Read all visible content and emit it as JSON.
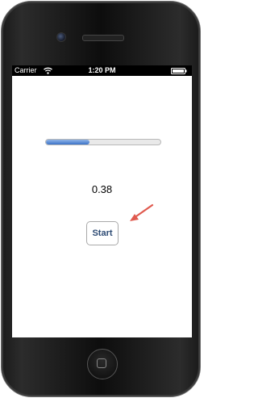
{
  "statusbar": {
    "carrier": "Carrier",
    "time": "1:20 PM"
  },
  "progress": {
    "fraction": 0.38,
    "fill_color": "#3b72c8"
  },
  "main": {
    "value_text": "0.38",
    "start_label": "Start"
  },
  "annotation": {
    "arrow_color": "#e05a4f"
  }
}
